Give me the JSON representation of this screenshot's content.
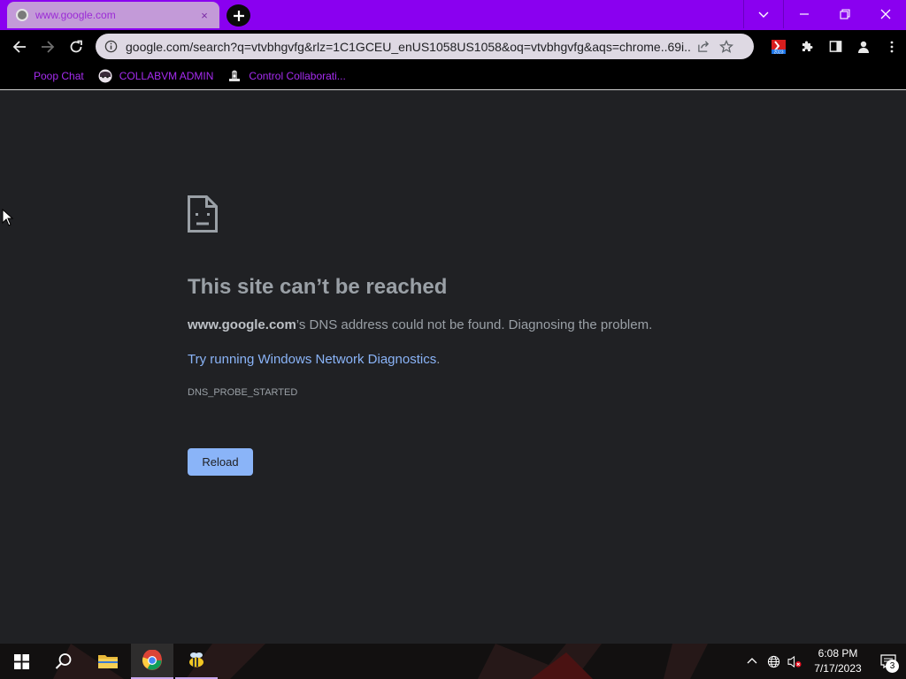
{
  "window": {
    "tab_title": "www.google.com",
    "tab_close": "×",
    "accent_color": "#8a00f0"
  },
  "toolbar": {
    "url": "google.com/search?q=vtvbhgvfg&rlz=1C1GCEU_enUS1058US1058&oq=vtvbhgvfg&aqs=chrome..69i...",
    "extension_badge": "2023"
  },
  "bookmarks": [
    {
      "label": "Poop Chat",
      "icon": "none"
    },
    {
      "label": "COLLABVM ADMIN",
      "icon": "avatar"
    },
    {
      "label": "Control Collaborati...",
      "icon": "hat"
    }
  ],
  "error": {
    "title": "This site can’t be reached",
    "host": "www.google.com",
    "desc_rest": "’s DNS address could not be found. Diagnosing the problem.",
    "link": "Try running Windows Network Diagnostics",
    "link_dot": ".",
    "code": "DNS_PROBE_STARTED",
    "reload_label": "Reload",
    "link_color": "#8ab4f8"
  },
  "taskbar": {
    "time": "6:08 PM",
    "date": "7/17/2023",
    "notification_count": "3"
  }
}
